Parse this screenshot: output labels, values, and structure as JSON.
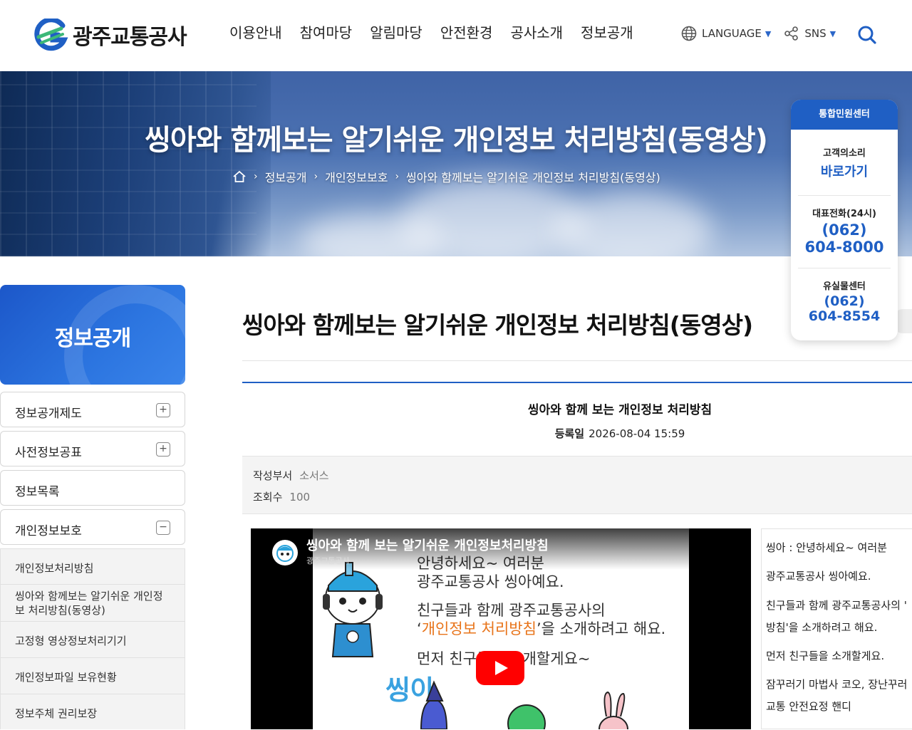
{
  "header": {
    "logo_text": "광주교통공사",
    "nav": [
      "이용안내",
      "참여마당",
      "알림마당",
      "안전환경",
      "공사소개",
      "정보공개"
    ],
    "language_label": "LANGUAGE",
    "sns_label": "SNS"
  },
  "hero": {
    "title": "씽아와 함께보는 알기쉬운 개인정보 처리방침(동영상)",
    "breadcrumb": [
      "정보공개",
      "개인정보보호",
      "씽아와 함께보는 알기쉬운 개인정보 처리방침(동영상)"
    ]
  },
  "quick_panel": {
    "title": "통합민원센터",
    "voice_label": "고객의소리",
    "voice_link": "바로가기",
    "main_phone_label": "대표전화(24시)",
    "main_phone_area": "(062)",
    "main_phone_number": "604-8000",
    "lost_label": "유실물센터",
    "lost_phone_area": "(062)",
    "lost_phone_number": "604-8554"
  },
  "sidebar": {
    "title": "정보공개",
    "items": [
      {
        "label": "정보공개제도",
        "toggle": "+"
      },
      {
        "label": "사전정보공표",
        "toggle": "+"
      },
      {
        "label": "정보목록",
        "toggle": ""
      },
      {
        "label": "개인정보보호",
        "toggle": "−"
      }
    ],
    "sub_items": [
      "개인정보처리방침",
      "씽아와 함께보는 알기쉬운 개인정보 처리방침(동영상)",
      "고정형 영상정보처리기기",
      "개인정보파일 보유현황",
      "정보주체 권리보장"
    ]
  },
  "content": {
    "page_title": "씽아와 함께보는 알기쉬운 개인정보 처리방침(동영상)",
    "article_title": "씽아와 함께 보는 개인정보 처리방침",
    "date_label": "등록일",
    "date_value": "2026-08-04 15:59",
    "dept_label": "작성부서",
    "dept_value": "소서스",
    "views_label": "조회수",
    "views_value": "100"
  },
  "video": {
    "title": "씽아와 함께 보는 알기쉬운 개인정보처리방침",
    "channel": "광주교통공사",
    "line1": "안녕하세요~ 여러분",
    "line2": "광주교통공사 씽아예요.",
    "line3": "친구들과 함께 광주교통공사의",
    "line4_pre": "‘",
    "line4_hl": "개인정보 처리방침",
    "line4_post": "’을 소개하려고 해요.",
    "line5": "먼저 친구들을 소개할게요~",
    "mascot_name": "씽아"
  },
  "script_lines": [
    "씽아 : 안녕하세요~ 여러분",
    "광주교통공사 씽아예요.",
    "친구들과 함께 광주교통공사의 '",
    "방침'을 소개하려고 해요.",
    "먼저 친구들을 소개할게요.",
    "잠꾸러기 마법사 코오, 장난꾸러",
    "교통 안전요정 핸디"
  ],
  "colors": {
    "brand_blue": "#1f5fc4",
    "accent_orange": "#e8741a",
    "play_red": "#ff0000"
  }
}
